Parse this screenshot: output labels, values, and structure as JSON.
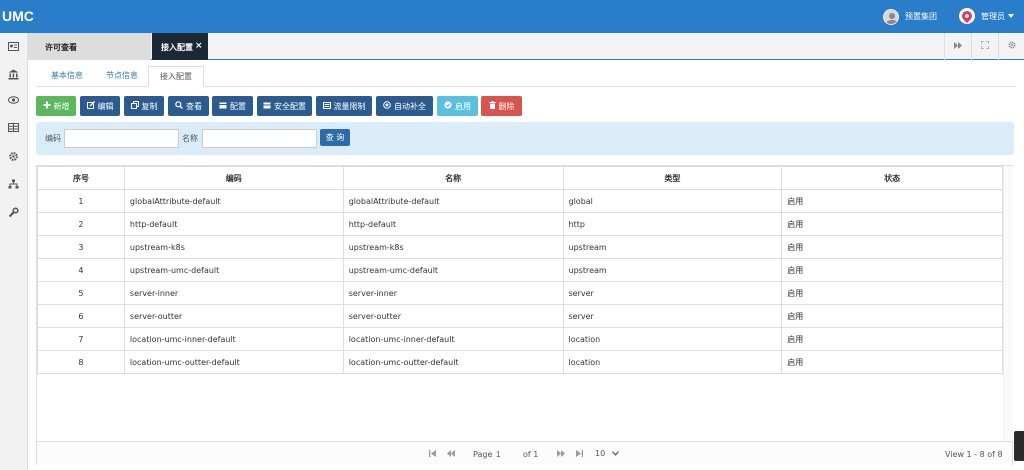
{
  "app": {
    "logo": "UMC"
  },
  "header": {
    "org_name": "预置集团",
    "user_name": "管理员"
  },
  "sidebar": {
    "icons": [
      "id-card-icon",
      "bank-icon",
      "eye-icon",
      "table-icon",
      "gear-icon",
      "sitemap-icon",
      "wrench-icon"
    ]
  },
  "tabs": {
    "items": [
      {
        "label": "许可查看"
      },
      {
        "label": "接入配置"
      }
    ],
    "close_glyph": "×",
    "controls": [
      "forward-icon",
      "fullscreen-icon",
      "settings-icon"
    ]
  },
  "subtabs": [
    {
      "label": "基本信息"
    },
    {
      "label": "节点信息"
    },
    {
      "label": "接入配置"
    }
  ],
  "toolbar": {
    "buttons": [
      {
        "label": "新增",
        "icon": "plus-icon",
        "color": "#5cb85c"
      },
      {
        "label": "编辑",
        "icon": "edit-icon",
        "color": "#2c5c8f"
      },
      {
        "label": "复制",
        "icon": "copy-icon",
        "color": "#2c5c8f"
      },
      {
        "label": "查看",
        "icon": "search-icon",
        "color": "#2c5c8f"
      },
      {
        "label": "配置",
        "icon": "config-icon",
        "color": "#2c5c8f"
      },
      {
        "label": "安全配置",
        "icon": "security-icon",
        "color": "#2c5c8f"
      },
      {
        "label": "流量限制",
        "icon": "traffic-icon",
        "color": "#2c5c8f"
      },
      {
        "label": "自动补全",
        "icon": "autocomplete-icon",
        "color": "#2c5c8f"
      },
      {
        "label": "启用",
        "icon": "check-icon",
        "color": "#5bc0de"
      },
      {
        "label": "删除",
        "icon": "trash-icon",
        "color": "#d9534f"
      }
    ]
  },
  "search": {
    "code_label": "编码",
    "name_label": "名称",
    "code_value": "",
    "name_value": "",
    "button_label": "查 询"
  },
  "table": {
    "columns": [
      "序号",
      "编码",
      "名称",
      "类型",
      "状态"
    ],
    "rows": [
      [
        "1",
        "globalAttribute-default",
        "globalAttribute-default",
        "global",
        "启用"
      ],
      [
        "2",
        "http-default",
        "http-default",
        "http",
        "启用"
      ],
      [
        "3",
        "upstream-k8s",
        "upstream-k8s",
        "upstream",
        "启用"
      ],
      [
        "4",
        "upstream-umc-default",
        "upstream-umc-default",
        "upstream",
        "启用"
      ],
      [
        "5",
        "server-inner",
        "server-inner",
        "server",
        "启用"
      ],
      [
        "6",
        "server-outter",
        "server-outter",
        "server",
        "启用"
      ],
      [
        "7",
        "location-umc-inner-default",
        "location-umc-inner-default",
        "location",
        "启用"
      ],
      [
        "8",
        "location-umc-outter-default",
        "location-umc-outter-default",
        "location",
        "启用"
      ]
    ]
  },
  "pager": {
    "page_label": "Page",
    "page_value": "1",
    "of_label": "of 1",
    "page_size": "10",
    "view_text": "View 1 - 8 of 8"
  },
  "colors": {
    "header": "#2a7dc9",
    "primary_button": "#2c5c8f",
    "search_panel": "#d9ecf7"
  }
}
